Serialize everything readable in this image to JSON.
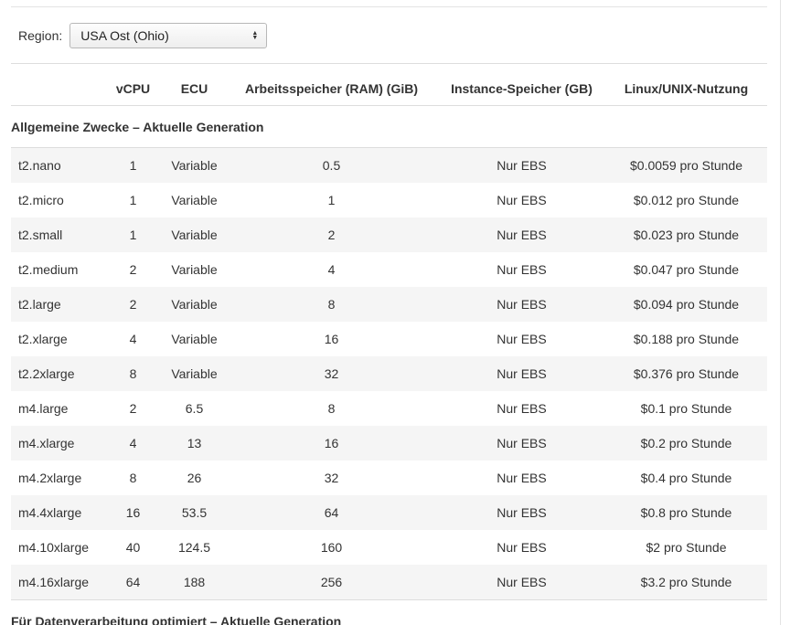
{
  "region": {
    "label": "Region:",
    "selected": "USA Ost (Ohio)"
  },
  "table": {
    "headers": [
      "",
      "vCPU",
      "ECU",
      "Arbeitsspeicher (RAM) (GiB)",
      "Instance-Speicher (GB)",
      "Linux/UNIX-Nutzung"
    ],
    "section_title": "Allgemeine Zwecke – Aktuelle Generation",
    "rows": [
      [
        "t2.nano",
        "1",
        "Variable",
        "0.5",
        "Nur EBS",
        "$0.0059 pro Stunde"
      ],
      [
        "t2.micro",
        "1",
        "Variable",
        "1",
        "Nur EBS",
        "$0.012 pro Stunde"
      ],
      [
        "t2.small",
        "1",
        "Variable",
        "2",
        "Nur EBS",
        "$0.023 pro Stunde"
      ],
      [
        "t2.medium",
        "2",
        "Variable",
        "4",
        "Nur EBS",
        "$0.047 pro Stunde"
      ],
      [
        "t2.large",
        "2",
        "Variable",
        "8",
        "Nur EBS",
        "$0.094 pro Stunde"
      ],
      [
        "t2.xlarge",
        "4",
        "Variable",
        "16",
        "Nur EBS",
        "$0.188 pro Stunde"
      ],
      [
        "t2.2xlarge",
        "8",
        "Variable",
        "32",
        "Nur EBS",
        "$0.376 pro Stunde"
      ],
      [
        "m4.large",
        "2",
        "6.5",
        "8",
        "Nur EBS",
        "$0.1 pro Stunde"
      ],
      [
        "m4.xlarge",
        "4",
        "13",
        "16",
        "Nur EBS",
        "$0.2 pro Stunde"
      ],
      [
        "m4.2xlarge",
        "8",
        "26",
        "32",
        "Nur EBS",
        "$0.4 pro Stunde"
      ],
      [
        "m4.4xlarge",
        "16",
        "53.5",
        "64",
        "Nur EBS",
        "$0.8 pro Stunde"
      ],
      [
        "m4.10xlarge",
        "40",
        "124.5",
        "160",
        "Nur EBS",
        "$2 pro Stunde"
      ],
      [
        "m4.16xlarge",
        "64",
        "188",
        "256",
        "Nur EBS",
        "$3.2 pro Stunde"
      ]
    ]
  },
  "next_section_title": "Für Datenverarbeitung optimiert – Aktuelle Generation"
}
